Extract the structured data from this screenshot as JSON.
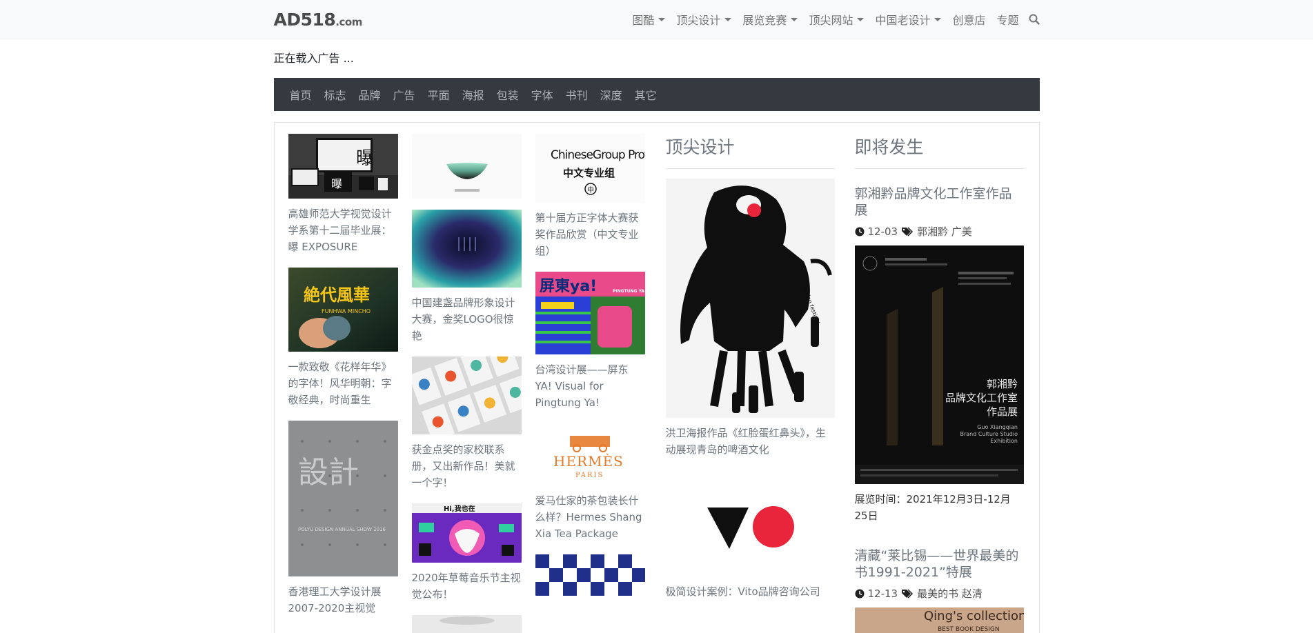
{
  "header": {
    "brand": "AD518",
    "brand_suffix": ".com",
    "nav": [
      {
        "label": "图酷",
        "dropdown": true
      },
      {
        "label": "顶尖设计",
        "dropdown": true
      },
      {
        "label": "展览竞赛",
        "dropdown": true
      },
      {
        "label": "顶尖网站",
        "dropdown": true
      },
      {
        "label": "中国老设计",
        "dropdown": true
      },
      {
        "label": "创意店",
        "dropdown": false
      },
      {
        "label": "专题",
        "dropdown": false
      }
    ],
    "search_icon": "search-icon"
  },
  "ad_loading": "正在载入广告 ...",
  "categories": [
    "首页",
    "标志",
    "品牌",
    "广告",
    "平面",
    "海报",
    "包装",
    "字体",
    "书刊",
    "深度",
    "其它"
  ],
  "col1": [
    {
      "caption": "高雄师范大学视觉设计学系第十二届毕业展：曝 EXPOSURE"
    },
    {
      "caption": "一款致敬《花样年华》的字体！风华明朝：字敬经典，时尚重生",
      "img_text": "絶代風華",
      "img_sub": "FUNHWA MINCHO"
    },
    {
      "caption": "香港理工大学设计展2007-2020主视觉",
      "img_text": "設計",
      "img_sub": "POLYU DESIGN ANNUAL SHOW 2016"
    }
  ],
  "col2": [
    {
      "caption": ""
    },
    {
      "caption": "中国建盏品牌形象设计大赛，金奖LOGO很惊艳"
    },
    {
      "caption": "获金点奖的家校联系册，又出新作品！美就一个字！"
    },
    {
      "caption": "2020年草莓音乐节主视觉公布！",
      "img_text": "Hi,我也在"
    },
    {
      "caption": ""
    }
  ],
  "col3": [
    {
      "caption": "第十届方正字体大赛获奖作品欣赏（中文专业组）",
      "img_text": "ChineseGroup Professional",
      "img_sub": "中文专业组"
    },
    {
      "caption": "台湾设计展——屏东YA! Visual for Pingtung Ya!",
      "img_text": "屏東ya!",
      "img_sub": "PINGTUNG YA"
    },
    {
      "caption": "爱马仕家的茶包装长什么样？Hermes Shang Xia Tea Package",
      "img_text": "HERMÈS",
      "img_sub": "PARIS"
    },
    {
      "caption": ""
    }
  ],
  "top_design": {
    "heading": "顶尖设计",
    "items": [
      {
        "caption": "洪卫海报作品《红脸蛋红鼻头》，生动展现青岛的啤酒文化"
      },
      {
        "caption": "极简设计案例：Vito品牌咨询公司"
      }
    ]
  },
  "upcoming": {
    "heading": "即将发生",
    "events": [
      {
        "title": "郭湘黔品牌文化工作室作品展",
        "date": "12-03",
        "tags": "郭湘黔 广美",
        "poster_title": "郭湘黔 品牌文化工作室 作品展",
        "poster_en": "Guo Xiangqian Brand Culture Studio Exhibition",
        "desc": "展览时间：2021年12月3日-12月25日"
      },
      {
        "title": "清藏“莱比锡——世界最美的书1991-2021”特展",
        "date": "12-13",
        "tags": "最美的书 赵清",
        "poster_title": "Qing's collection",
        "poster_sub": "BEST BOOK DESIGN"
      }
    ]
  },
  "colors": {
    "topbar": "#f8f9fa",
    "catbar": "#343a40",
    "accent_red": "#e8253a"
  }
}
